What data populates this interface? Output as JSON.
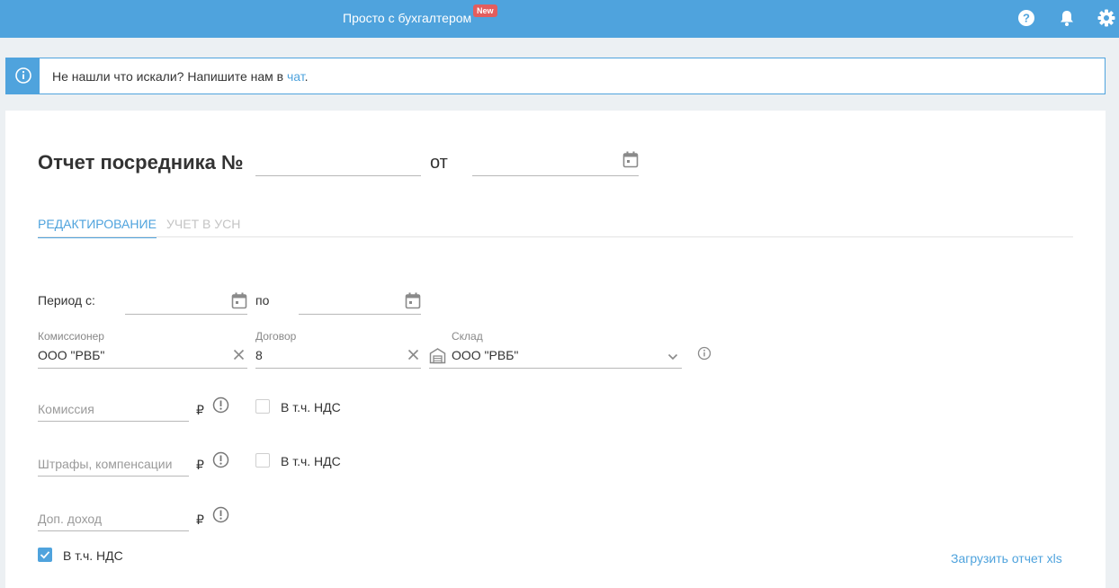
{
  "header": {
    "promo_text": "Просто с бухгалтером",
    "promo_badge": "New",
    "icons": [
      "help-icon",
      "bell-icon",
      "gear-icon"
    ],
    "accent_color": "#4fa3dd",
    "badge_color": "#e35d5d"
  },
  "info": {
    "icon": "info-icon",
    "message_prefix": "Не нашли что искали? Напишите нам в ",
    "chat_link": "чат",
    "message_suffix": "."
  },
  "report": {
    "title": "Отчет посредника №",
    "number_value": "",
    "date_separator": "от",
    "date_value": ""
  },
  "tabs": [
    {
      "label": "РЕДАКТИРОВАНИЕ",
      "active": true
    },
    {
      "label": "УЧЕТ В УСН",
      "active": false
    }
  ],
  "form": {
    "period_label": "Период с:",
    "period_from": "",
    "period_to_label": "по",
    "period_to": "",
    "commissioner_label": "Комиссионер",
    "commissioner_value": "ООО \"РВБ\"",
    "contract_label": "Договор",
    "contract_value": "8",
    "warehouse_label": "Склад",
    "warehouse_value": "ООО \"РВБ\"",
    "commission_placeholder": "Комиссия",
    "fines_placeholder": "Штрафы, компенсации",
    "extra_income_placeholder": "Доп. доход",
    "currency": "₽",
    "vat_label": "В т.ч. НДС",
    "vat_commission_checked": false,
    "vat_fines_checked": false,
    "vat_income_checked": true,
    "upload_link": "Загрузить отчет xls"
  }
}
